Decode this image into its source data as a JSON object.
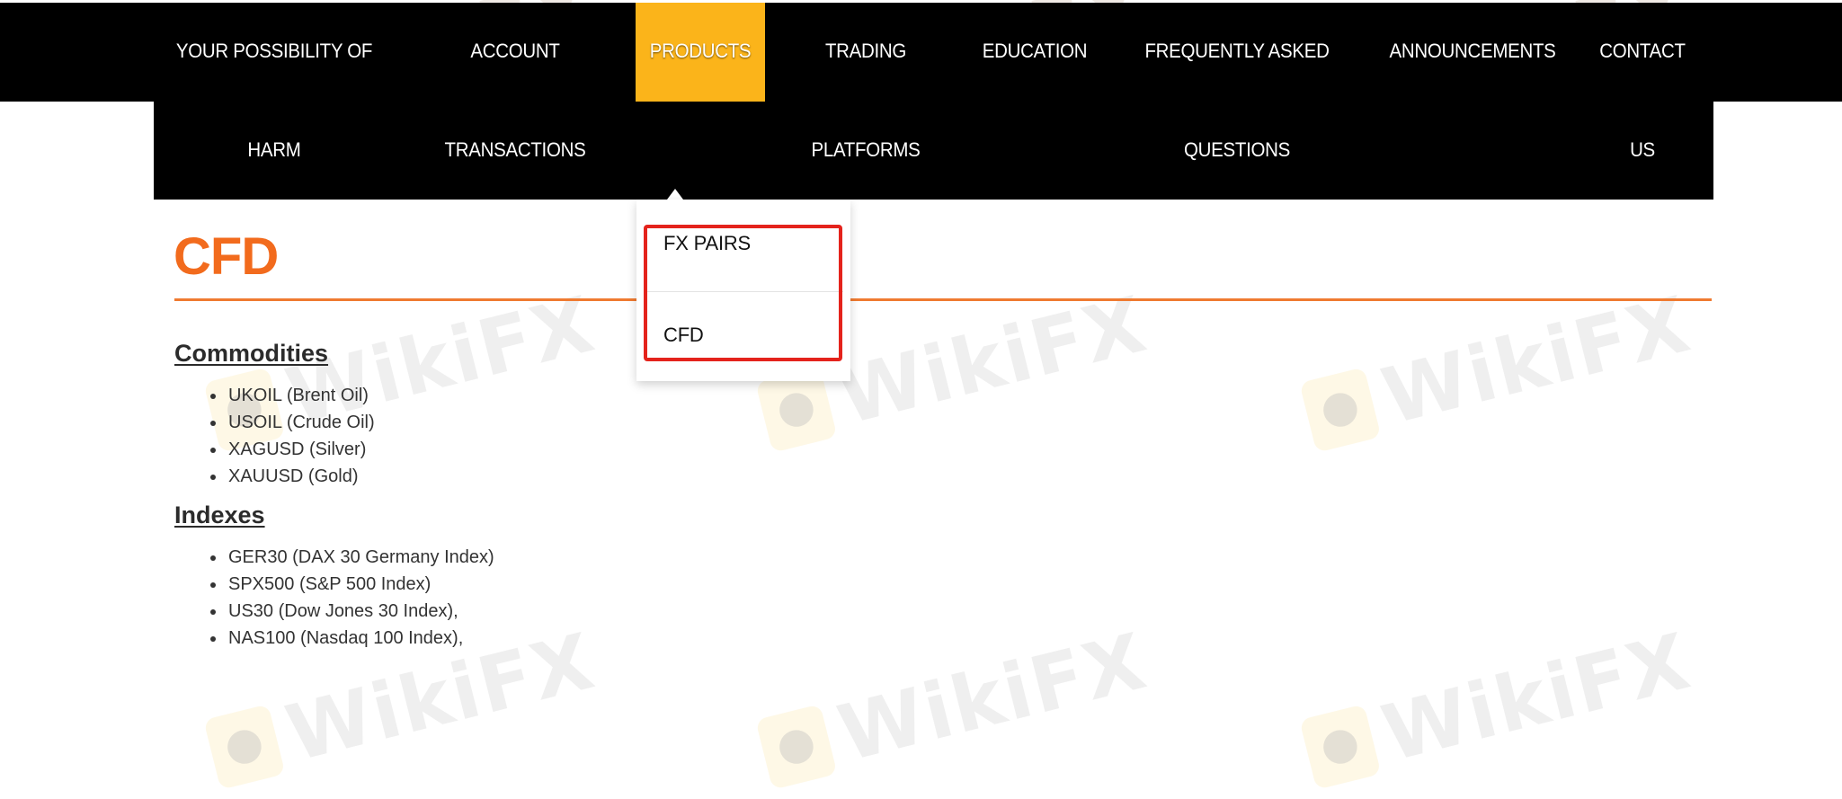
{
  "nav": {
    "items": [
      {
        "line1": "YOUR POSSIBILITY OF",
        "line2": "HARM"
      },
      {
        "line1": "ACCOUNT",
        "line2": "TRANSACTIONS"
      },
      {
        "line1": "PRODUCTS",
        "line2": ""
      },
      {
        "line1": "TRADING",
        "line2": "PLATFORMS"
      },
      {
        "line1": "EDUCATION",
        "line2": ""
      },
      {
        "line1": "FREQUENTLY ASKED",
        "line2": "QUESTIONS"
      },
      {
        "line1": "ANNOUNCEMENTS",
        "line2": ""
      },
      {
        "line1": "CONTACT",
        "line2": "US"
      }
    ],
    "active_index": 2,
    "active_color": "#fbb41a"
  },
  "dropdown": {
    "items": [
      "FX PAIRS",
      "CFD"
    ],
    "highlight_color": "#e4231c"
  },
  "page": {
    "title": "CFD",
    "title_color": "#f26b1d",
    "sections": [
      {
        "heading": "Commodities",
        "items": [
          "UKOIL (Brent Oil)",
          "USOIL (Crude Oil)",
          "XAGUSD (Silver)",
          "XAUUSD (Gold)"
        ]
      },
      {
        "heading": "Indexes",
        "items": [
          "GER30 (DAX 30 Germany Index)",
          "SPX500 (S&P 500 Index)",
          "US30 (Dow Jones 30 Index),",
          "NAS100 (Nasdaq 100 Index),"
        ]
      }
    ]
  },
  "watermark": {
    "text": "WikiFX",
    "icon": "eagle-logo-icon"
  }
}
